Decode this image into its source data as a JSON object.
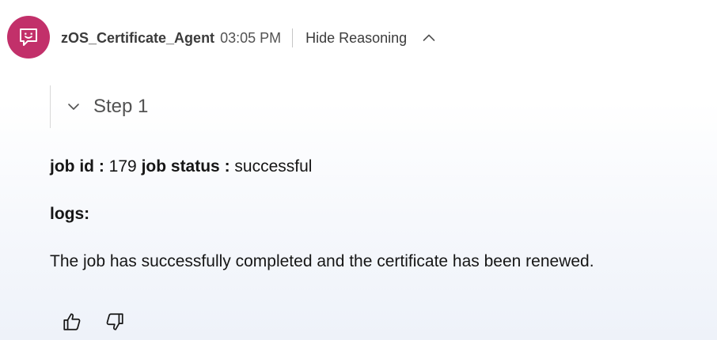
{
  "message": {
    "agent_name": "zOS_Certificate_Agent",
    "time": "03:05 PM",
    "reasoning_toggle_label": "Hide Reasoning",
    "avatar_icon": "chat-bot-icon",
    "avatar_color": "#c2306a",
    "reasoning": {
      "expanded": true,
      "steps": [
        {
          "label": "Step 1",
          "expanded": false
        }
      ]
    },
    "body": {
      "job_id_label": "job id :",
      "job_id_value": "179",
      "job_status_label": "job status :",
      "job_status_value": "successful",
      "logs_label": "logs:",
      "logs_text": "The job has successfully completed and the certificate has been renewed."
    },
    "feedback": {
      "like_icon": "thumbs-up-icon",
      "dislike_icon": "thumbs-down-icon"
    }
  }
}
